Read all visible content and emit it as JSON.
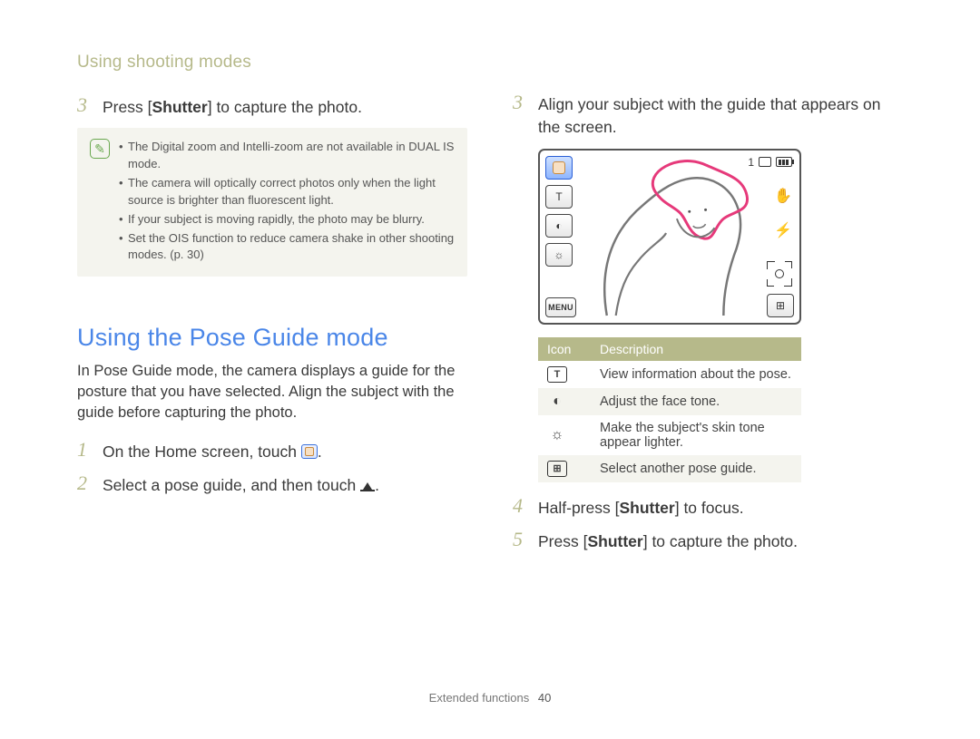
{
  "section_label": "Using shooting modes",
  "left": {
    "step3": {
      "num": "3",
      "pre": "Press [",
      "bold": "Shutter",
      "post": "] to capture the photo."
    },
    "note_items": [
      "The Digital zoom and Intelli-zoom are not available in DUAL IS mode.",
      "The camera will optically correct photos only when the light source is brighter than fluorescent light.",
      "If your subject is moving rapidly, the photo may be blurry.",
      "Set the OIS function to reduce camera shake in other shooting modes. (p. 30)"
    ],
    "h2": "Using the Pose Guide mode",
    "intro": "In Pose Guide mode, the camera displays a guide for the posture that you have selected. Align the subject with the guide before capturing the photo.",
    "step1": {
      "num": "1",
      "pre": "On the Home screen, touch ",
      "post": "."
    },
    "step2": {
      "num": "2",
      "pre": "Select a pose guide, and then touch ",
      "post": "."
    }
  },
  "right": {
    "step3": {
      "num": "3",
      "text": "Align your subject with the guide that appears on the screen."
    },
    "screen": {
      "menu_label": "MENU",
      "counter": "1",
      "left_t_label": "T"
    },
    "table": {
      "head_icon": "Icon",
      "head_desc": "Description",
      "rows": [
        {
          "icon_label": "T",
          "icon_style": "boxed",
          "desc": "View information about the pose."
        },
        {
          "icon_label": "◐",
          "icon_style": "circle-half",
          "desc": "Adjust the face tone."
        },
        {
          "icon_label": "☼",
          "icon_style": "sun",
          "desc": "Make the subject's skin tone appear lighter."
        },
        {
          "icon_label": "⊞",
          "icon_style": "grid",
          "desc": "Select another pose guide."
        }
      ]
    },
    "step4": {
      "num": "4",
      "pre": "Half-press [",
      "bold": "Shutter",
      "post": "] to focus."
    },
    "step5": {
      "num": "5",
      "pre": "Press [",
      "bold": "Shutter",
      "post": "] to capture the photo."
    }
  },
  "footer": {
    "label": "Extended functions",
    "page": "40"
  }
}
